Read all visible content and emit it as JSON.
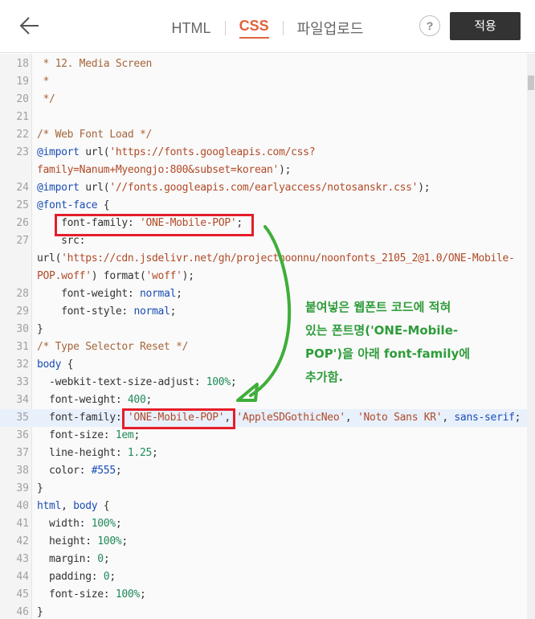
{
  "header": {
    "back_icon": "back-arrow-icon",
    "tabs": [
      {
        "label": "HTML",
        "active": false
      },
      {
        "label": "CSS",
        "active": true
      },
      {
        "label": "파일업로드",
        "active": false
      }
    ],
    "help_label": "?",
    "apply_label": "적용",
    "colors": {
      "active_tab": "#e0643c",
      "apply_bg": "#333333"
    }
  },
  "editor": {
    "highlight_line": "35",
    "lines": [
      {
        "n": "18",
        "code": [
          {
            "t": " * 12. Media Screen",
            "c": "c"
          }
        ]
      },
      {
        "n": "19",
        "code": [
          {
            "t": " *",
            "c": "c"
          }
        ]
      },
      {
        "n": "20",
        "code": [
          {
            "t": " */",
            "c": "c"
          }
        ]
      },
      {
        "n": "21",
        "code": []
      },
      {
        "n": "22",
        "code": [
          {
            "t": "/* Web Font Load */",
            "c": "c"
          }
        ]
      },
      {
        "n": "23",
        "code": [
          {
            "t": "@import",
            "c": "k"
          },
          {
            "t": " url(",
            "c": ""
          },
          {
            "t": "'https://fonts.googleapis.com/css?",
            "c": "s"
          }
        ]
      },
      {
        "n": "",
        "code": [
          {
            "t": "family=Nanum+Myeongjo:800&subset=korean'",
            "c": "s"
          },
          {
            "t": ");",
            "c": ""
          }
        ]
      },
      {
        "n": "24",
        "code": [
          {
            "t": "@import",
            "c": "k"
          },
          {
            "t": " url(",
            "c": ""
          },
          {
            "t": "'//fonts.googleapis.com/earlyaccess/notosanskr.css'",
            "c": "s"
          },
          {
            "t": ");",
            "c": ""
          }
        ]
      },
      {
        "n": "25",
        "code": [
          {
            "t": "@font-face",
            "c": "k"
          },
          {
            "t": " {",
            "c": ""
          }
        ]
      },
      {
        "n": "26",
        "code": [
          {
            "t": "    font-family: ",
            "c": ""
          },
          {
            "t": "'ONE-Mobile-POP'",
            "c": "s"
          },
          {
            "t": ";",
            "c": ""
          }
        ]
      },
      {
        "n": "27",
        "code": [
          {
            "t": "    src:",
            "c": ""
          }
        ]
      },
      {
        "n": "",
        "code": [
          {
            "t": "url(",
            "c": ""
          },
          {
            "t": "'https://cdn.jsdelivr.net/gh/projectnoonnu/noonfonts_2105_2@1.0/ONE-Mobile-",
            "c": "s"
          }
        ]
      },
      {
        "n": "",
        "code": [
          {
            "t": "POP.woff'",
            "c": "s"
          },
          {
            "t": ") format(",
            "c": ""
          },
          {
            "t": "'woff'",
            "c": "s"
          },
          {
            "t": ");",
            "c": ""
          }
        ]
      },
      {
        "n": "28",
        "code": [
          {
            "t": "    font-weight: ",
            "c": ""
          },
          {
            "t": "normal",
            "c": "k"
          },
          {
            "t": ";",
            "c": ""
          }
        ]
      },
      {
        "n": "29",
        "code": [
          {
            "t": "    font-style: ",
            "c": ""
          },
          {
            "t": "normal",
            "c": "k"
          },
          {
            "t": ";",
            "c": ""
          }
        ]
      },
      {
        "n": "30",
        "code": [
          {
            "t": "}",
            "c": ""
          }
        ]
      },
      {
        "n": "31",
        "code": [
          {
            "t": "/* Type Selector Reset */",
            "c": "c"
          }
        ]
      },
      {
        "n": "32",
        "code": [
          {
            "t": "body",
            "c": "k"
          },
          {
            "t": " {",
            "c": ""
          }
        ]
      },
      {
        "n": "33",
        "code": [
          {
            "t": "  -webkit-text-size-adjust: ",
            "c": ""
          },
          {
            "t": "100%",
            "c": "n"
          },
          {
            "t": ";",
            "c": ""
          }
        ]
      },
      {
        "n": "34",
        "code": [
          {
            "t": "  font-weight: ",
            "c": ""
          },
          {
            "t": "400",
            "c": "n"
          },
          {
            "t": ";",
            "c": ""
          }
        ]
      },
      {
        "n": "35",
        "code": [
          {
            "t": "  font-family: ",
            "c": ""
          },
          {
            "t": "'ONE-Mobile-POP'",
            "c": "s"
          },
          {
            "t": ", ",
            "c": ""
          },
          {
            "t": "'AppleSDGothicNeo'",
            "c": "s"
          },
          {
            "t": ", ",
            "c": ""
          },
          {
            "t": "'Noto Sans KR'",
            "c": "s"
          },
          {
            "t": ", ",
            "c": ""
          },
          {
            "t": "sans-serif",
            "c": "k"
          },
          {
            "t": ";",
            "c": ""
          }
        ]
      },
      {
        "n": "36",
        "code": [
          {
            "t": "  font-size: ",
            "c": ""
          },
          {
            "t": "1em",
            "c": "n"
          },
          {
            "t": ";",
            "c": ""
          }
        ]
      },
      {
        "n": "37",
        "code": [
          {
            "t": "  line-height: ",
            "c": ""
          },
          {
            "t": "1.25",
            "c": "n"
          },
          {
            "t": ";",
            "c": ""
          }
        ]
      },
      {
        "n": "38",
        "code": [
          {
            "t": "  color: ",
            "c": ""
          },
          {
            "t": "#555",
            "c": "k"
          },
          {
            "t": ";",
            "c": ""
          }
        ]
      },
      {
        "n": "39",
        "code": [
          {
            "t": "}",
            "c": ""
          }
        ]
      },
      {
        "n": "40",
        "code": [
          {
            "t": "html",
            "c": "k"
          },
          {
            "t": ", ",
            "c": ""
          },
          {
            "t": "body",
            "c": "k"
          },
          {
            "t": " {",
            "c": ""
          }
        ]
      },
      {
        "n": "41",
        "code": [
          {
            "t": "  width: ",
            "c": ""
          },
          {
            "t": "100%",
            "c": "n"
          },
          {
            "t": ";",
            "c": ""
          }
        ]
      },
      {
        "n": "42",
        "code": [
          {
            "t": "  height: ",
            "c": ""
          },
          {
            "t": "100%",
            "c": "n"
          },
          {
            "t": ";",
            "c": ""
          }
        ]
      },
      {
        "n": "43",
        "code": [
          {
            "t": "  margin: ",
            "c": ""
          },
          {
            "t": "0",
            "c": "n"
          },
          {
            "t": ";",
            "c": ""
          }
        ]
      },
      {
        "n": "44",
        "code": [
          {
            "t": "  padding: ",
            "c": ""
          },
          {
            "t": "0",
            "c": "n"
          },
          {
            "t": ";",
            "c": ""
          }
        ]
      },
      {
        "n": "45",
        "code": [
          {
            "t": "  font-size: ",
            "c": ""
          },
          {
            "t": "100%",
            "c": "n"
          },
          {
            "t": ";",
            "c": ""
          }
        ]
      },
      {
        "n": "46",
        "code": [
          {
            "t": "}",
            "c": ""
          }
        ]
      }
    ]
  },
  "annotation": {
    "note_lines": [
      "붙여넣은 웹폰트 코드에 적혀",
      "있는 폰트명('ONE-Mobile-",
      "POP')을 아래 font-family에",
      "추가함."
    ],
    "box_color": "#e41e2a",
    "note_color": "#2e9c3a"
  }
}
